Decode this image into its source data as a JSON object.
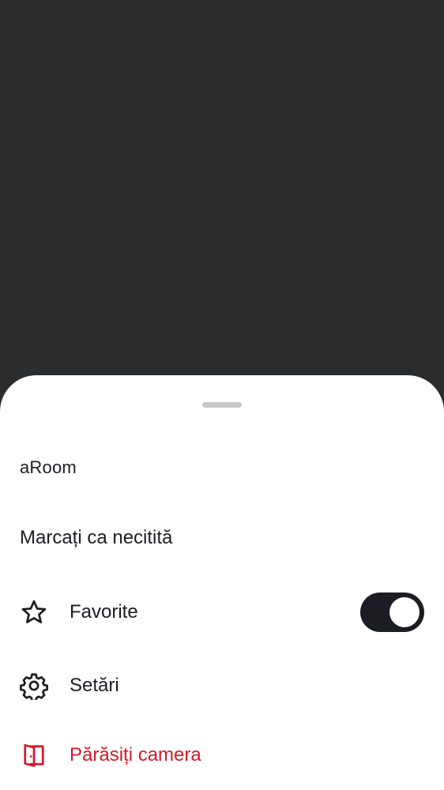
{
  "sheet": {
    "title": "aRoom",
    "items": [
      {
        "label": "Marcați ca necitită",
        "icon": ""
      },
      {
        "label": "Favorite",
        "icon": "star-icon",
        "toggle": {
          "on": true
        }
      },
      {
        "label": "Setări",
        "icon": "gear-icon"
      },
      {
        "label": "Părăsiți camera",
        "icon": "door-exit-icon",
        "color": "#d51928"
      }
    ]
  },
  "colors": {
    "scrim": "#2b2c2e",
    "text": "#1b1d22",
    "danger": "#d51928",
    "toggle_on": "#1b1d22"
  }
}
